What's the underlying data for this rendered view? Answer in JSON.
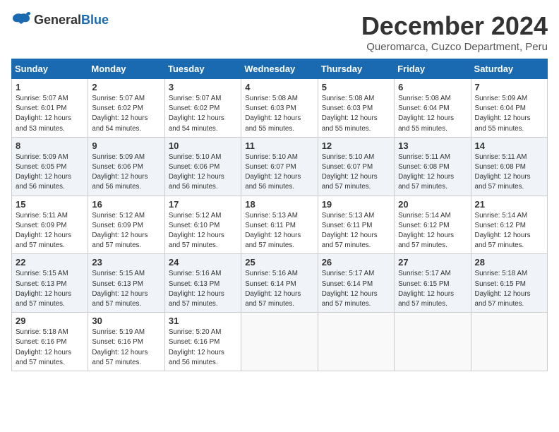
{
  "header": {
    "logo_general": "General",
    "logo_blue": "Blue",
    "month_title": "December 2024",
    "subtitle": "Queromarca, Cuzco Department, Peru"
  },
  "calendar": {
    "days_of_week": [
      "Sunday",
      "Monday",
      "Tuesday",
      "Wednesday",
      "Thursday",
      "Friday",
      "Saturday"
    ],
    "weeks": [
      [
        {
          "day": "",
          "info": ""
        },
        {
          "day": "2",
          "info": "Sunrise: 5:07 AM\nSunset: 6:02 PM\nDaylight: 12 hours\nand 54 minutes."
        },
        {
          "day": "3",
          "info": "Sunrise: 5:07 AM\nSunset: 6:02 PM\nDaylight: 12 hours\nand 54 minutes."
        },
        {
          "day": "4",
          "info": "Sunrise: 5:08 AM\nSunset: 6:03 PM\nDaylight: 12 hours\nand 55 minutes."
        },
        {
          "day": "5",
          "info": "Sunrise: 5:08 AM\nSunset: 6:03 PM\nDaylight: 12 hours\nand 55 minutes."
        },
        {
          "day": "6",
          "info": "Sunrise: 5:08 AM\nSunset: 6:04 PM\nDaylight: 12 hours\nand 55 minutes."
        },
        {
          "day": "7",
          "info": "Sunrise: 5:09 AM\nSunset: 6:04 PM\nDaylight: 12 hours\nand 55 minutes."
        }
      ],
      [
        {
          "day": "8",
          "info": "Sunrise: 5:09 AM\nSunset: 6:05 PM\nDaylight: 12 hours\nand 56 minutes."
        },
        {
          "day": "9",
          "info": "Sunrise: 5:09 AM\nSunset: 6:06 PM\nDaylight: 12 hours\nand 56 minutes."
        },
        {
          "day": "10",
          "info": "Sunrise: 5:10 AM\nSunset: 6:06 PM\nDaylight: 12 hours\nand 56 minutes."
        },
        {
          "day": "11",
          "info": "Sunrise: 5:10 AM\nSunset: 6:07 PM\nDaylight: 12 hours\nand 56 minutes."
        },
        {
          "day": "12",
          "info": "Sunrise: 5:10 AM\nSunset: 6:07 PM\nDaylight: 12 hours\nand 57 minutes."
        },
        {
          "day": "13",
          "info": "Sunrise: 5:11 AM\nSunset: 6:08 PM\nDaylight: 12 hours\nand 57 minutes."
        },
        {
          "day": "14",
          "info": "Sunrise: 5:11 AM\nSunset: 6:08 PM\nDaylight: 12 hours\nand 57 minutes."
        }
      ],
      [
        {
          "day": "15",
          "info": "Sunrise: 5:11 AM\nSunset: 6:09 PM\nDaylight: 12 hours\nand 57 minutes."
        },
        {
          "day": "16",
          "info": "Sunrise: 5:12 AM\nSunset: 6:09 PM\nDaylight: 12 hours\nand 57 minutes."
        },
        {
          "day": "17",
          "info": "Sunrise: 5:12 AM\nSunset: 6:10 PM\nDaylight: 12 hours\nand 57 minutes."
        },
        {
          "day": "18",
          "info": "Sunrise: 5:13 AM\nSunset: 6:11 PM\nDaylight: 12 hours\nand 57 minutes."
        },
        {
          "day": "19",
          "info": "Sunrise: 5:13 AM\nSunset: 6:11 PM\nDaylight: 12 hours\nand 57 minutes."
        },
        {
          "day": "20",
          "info": "Sunrise: 5:14 AM\nSunset: 6:12 PM\nDaylight: 12 hours\nand 57 minutes."
        },
        {
          "day": "21",
          "info": "Sunrise: 5:14 AM\nSunset: 6:12 PM\nDaylight: 12 hours\nand 57 minutes."
        }
      ],
      [
        {
          "day": "22",
          "info": "Sunrise: 5:15 AM\nSunset: 6:13 PM\nDaylight: 12 hours\nand 57 minutes."
        },
        {
          "day": "23",
          "info": "Sunrise: 5:15 AM\nSunset: 6:13 PM\nDaylight: 12 hours\nand 57 minutes."
        },
        {
          "day": "24",
          "info": "Sunrise: 5:16 AM\nSunset: 6:13 PM\nDaylight: 12 hours\nand 57 minutes."
        },
        {
          "day": "25",
          "info": "Sunrise: 5:16 AM\nSunset: 6:14 PM\nDaylight: 12 hours\nand 57 minutes."
        },
        {
          "day": "26",
          "info": "Sunrise: 5:17 AM\nSunset: 6:14 PM\nDaylight: 12 hours\nand 57 minutes."
        },
        {
          "day": "27",
          "info": "Sunrise: 5:17 AM\nSunset: 6:15 PM\nDaylight: 12 hours\nand 57 minutes."
        },
        {
          "day": "28",
          "info": "Sunrise: 5:18 AM\nSunset: 6:15 PM\nDaylight: 12 hours\nand 57 minutes."
        }
      ],
      [
        {
          "day": "29",
          "info": "Sunrise: 5:18 AM\nSunset: 6:16 PM\nDaylight: 12 hours\nand 57 minutes."
        },
        {
          "day": "30",
          "info": "Sunrise: 5:19 AM\nSunset: 6:16 PM\nDaylight: 12 hours\nand 57 minutes."
        },
        {
          "day": "31",
          "info": "Sunrise: 5:20 AM\nSunset: 6:16 PM\nDaylight: 12 hours\nand 56 minutes."
        },
        {
          "day": "",
          "info": ""
        },
        {
          "day": "",
          "info": ""
        },
        {
          "day": "",
          "info": ""
        },
        {
          "day": "",
          "info": ""
        }
      ]
    ],
    "first_week_day1": {
      "day": "1",
      "info": "Sunrise: 5:07 AM\nSunset: 6:01 PM\nDaylight: 12 hours\nand 53 minutes."
    }
  }
}
